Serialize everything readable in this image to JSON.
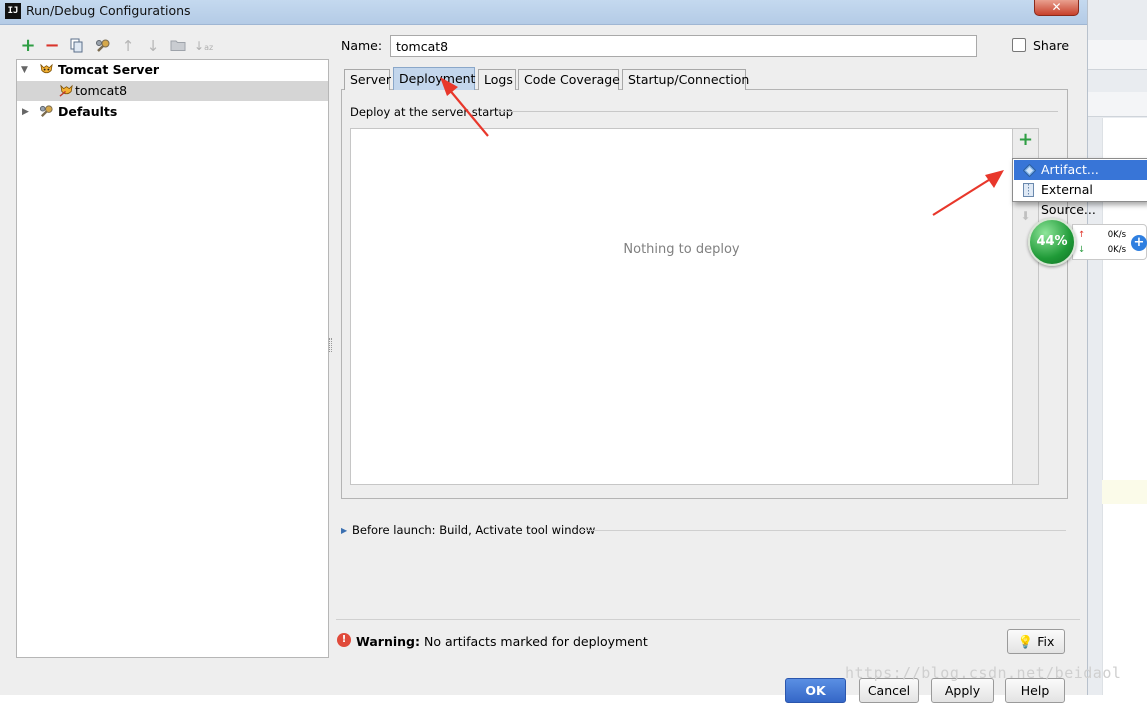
{
  "window": {
    "title": "Run/Debug Configurations",
    "app_icon": "IJ",
    "close_glyph": "✕"
  },
  "toolbar": {
    "add_icon": "+",
    "remove_icon": "−",
    "copy_icon": "⎘",
    "edit_defaults_icon": "🔧",
    "move_up_icon": "↑",
    "move_down_icon": "↓",
    "folder_icon": "▬",
    "sort_icon": "↓"
  },
  "tree": {
    "items": [
      {
        "label": "Tomcat Server",
        "expanded": true,
        "bold": true
      },
      {
        "label": "tomcat8",
        "selected": true
      },
      {
        "label": "Defaults",
        "expanded": false,
        "bold": true
      }
    ]
  },
  "form": {
    "name_label": "Name:",
    "name_value": "tomcat8",
    "share_label": "Share",
    "share_checked": false
  },
  "tabs": [
    {
      "label": "Server",
      "active": false
    },
    {
      "label": "Deployment",
      "active": true
    },
    {
      "label": "Logs",
      "active": false
    },
    {
      "label": "Code Coverage",
      "active": false
    },
    {
      "label": "Startup/Connection",
      "active": false
    }
  ],
  "deployment": {
    "section_title": "Deploy at the server startup",
    "empty_text": "Nothing to deploy",
    "add_icon": "+",
    "down_icon": "⬇"
  },
  "popup_menu": {
    "items": [
      {
        "label": "Artifact...",
        "selected": true
      },
      {
        "label": "External Source...",
        "selected": false
      }
    ]
  },
  "net_widget": {
    "percent": "44%",
    "up_speed": "0K/s",
    "down_speed": "0K/s",
    "plus_glyph": "+"
  },
  "before_launch": {
    "label": "Before launch: Build, Activate tool window"
  },
  "warning": {
    "bold": "Warning:",
    "text": "No artifacts marked for deployment",
    "fix_label": "Fix"
  },
  "buttons": {
    "ok": "OK",
    "cancel": "Cancel",
    "apply": "Apply",
    "help": "Help"
  },
  "watermark": "https://blog.csdn.net/beidaol",
  "colors": {
    "accent": "#3875d7",
    "arrow": "#e8372b",
    "add_green": "#2f9e44",
    "remove_red": "#d9342b",
    "warning_red": "#e04a3a"
  }
}
